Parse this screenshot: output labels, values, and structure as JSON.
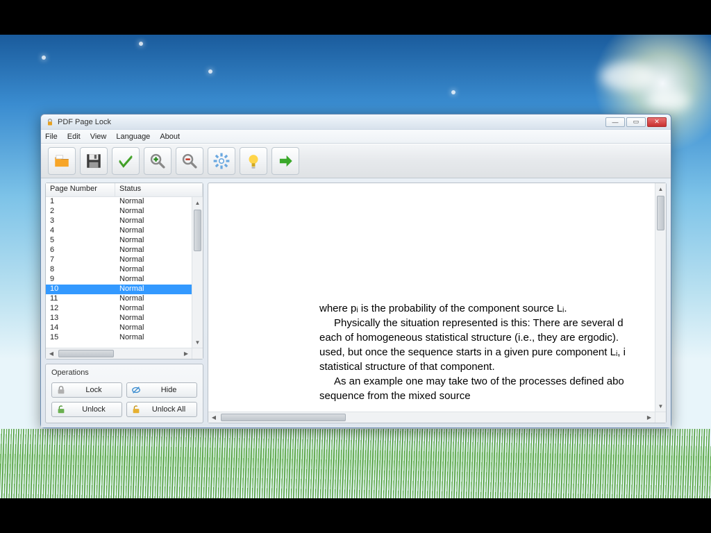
{
  "window": {
    "title": "PDF Page Lock"
  },
  "menu": {
    "file": "File",
    "edit": "Edit",
    "view": "View",
    "language": "Language",
    "about": "About"
  },
  "pagelist": {
    "col_page": "Page Number",
    "col_status": "Status",
    "selected_index": 9,
    "rows": [
      {
        "n": "1",
        "s": "Normal"
      },
      {
        "n": "2",
        "s": "Normal"
      },
      {
        "n": "3",
        "s": "Normal"
      },
      {
        "n": "4",
        "s": "Normal"
      },
      {
        "n": "5",
        "s": "Normal"
      },
      {
        "n": "6",
        "s": "Normal"
      },
      {
        "n": "7",
        "s": "Normal"
      },
      {
        "n": "8",
        "s": "Normal"
      },
      {
        "n": "9",
        "s": "Normal"
      },
      {
        "n": "10",
        "s": "Normal"
      },
      {
        "n": "11",
        "s": "Normal"
      },
      {
        "n": "12",
        "s": "Normal"
      },
      {
        "n": "13",
        "s": "Normal"
      },
      {
        "n": "14",
        "s": "Normal"
      },
      {
        "n": "15",
        "s": "Normal"
      }
    ]
  },
  "ops": {
    "title": "Operations",
    "lock": "Lock",
    "hide": "Hide",
    "unlock": "Unlock",
    "unlock_all": "Unlock All"
  },
  "doc": {
    "l1": "where pᵢ is the probability of the component source Lᵢ.",
    "l2": "Physically the situation represented is this: There are several d",
    "l3": "each of homogeneous statistical structure (i.e., they are ergodic).",
    "l4": "used, but once the sequence starts in a given pure component Lᵢ, i",
    "l5": "statistical structure of that component.",
    "l6": "As an example one may take two of the processes defined abo",
    "l7": "sequence from the mixed source"
  }
}
